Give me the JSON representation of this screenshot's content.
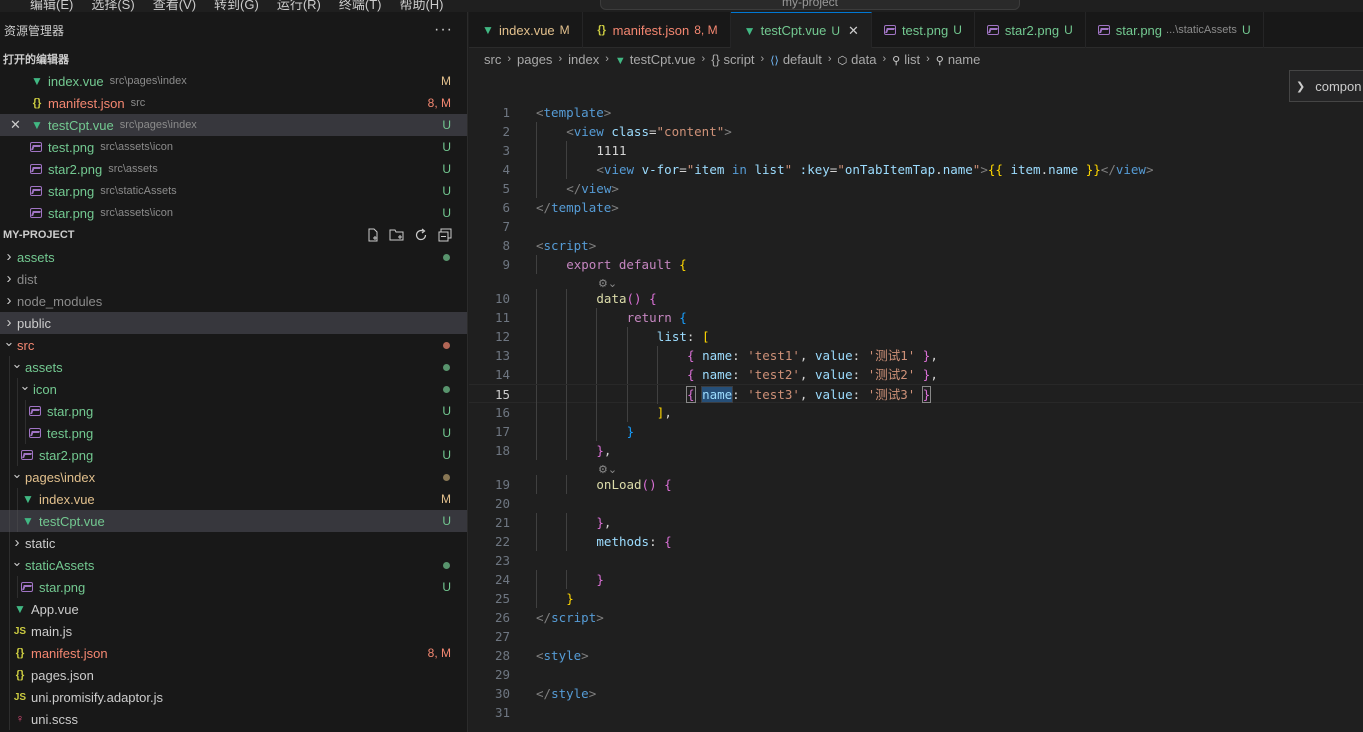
{
  "titlebar": {
    "menu": [
      "编辑(E)",
      "选择(S)",
      "查看(V)",
      "转到(G)",
      "运行(R)",
      "终端(T)",
      "帮助(H)"
    ],
    "command_center": "my-project"
  },
  "sidebar": {
    "title": "资源管理器",
    "more": "···",
    "open_editors_title": "打开的编辑器",
    "open_editors": [
      {
        "name": "index.vue",
        "path": "src\\pages\\index",
        "status": "M",
        "icon": "vue-icon",
        "color": "#73c991",
        "status_color": "#e2c08d"
      },
      {
        "name": "manifest.json",
        "path": "src",
        "status": "8, M",
        "icon": "json-icon",
        "color": "#f48771",
        "status_color": "#f48771"
      },
      {
        "name": "testCpt.vue",
        "path": "src\\pages\\index",
        "status": "U",
        "icon": "vue-icon",
        "color": "#73c991",
        "status_color": "#73c991",
        "selected": true
      },
      {
        "name": "test.png",
        "path": "src\\assets\\icon",
        "status": "U",
        "icon": "png-icon",
        "color": "#73c991",
        "status_color": "#73c991"
      },
      {
        "name": "star2.png",
        "path": "src\\assets",
        "status": "U",
        "icon": "png-icon",
        "color": "#73c991",
        "status_color": "#73c991"
      },
      {
        "name": "star.png",
        "path": "src\\staticAssets",
        "status": "U",
        "icon": "png-icon",
        "color": "#73c991",
        "status_color": "#73c991"
      },
      {
        "name": "star.png",
        "path": "src\\assets\\icon",
        "status": "U",
        "icon": "png-icon",
        "color": "#73c991",
        "status_color": "#73c991"
      }
    ],
    "project_title": "MY-PROJECT",
    "project_actions": [
      "new-file-icon",
      "new-folder-icon",
      "refresh-icon",
      "collapse-icon"
    ],
    "tree": [
      {
        "name": "assets",
        "level": 0,
        "type": "folder",
        "open": false,
        "color": "#73c991",
        "dot": "#73c991"
      },
      {
        "name": "dist",
        "level": 0,
        "type": "folder",
        "open": false,
        "color": "#8b8b8b"
      },
      {
        "name": "node_modules",
        "level": 0,
        "type": "folder",
        "open": false,
        "color": "#8b8b8b"
      },
      {
        "name": "public",
        "level": 0,
        "type": "folder",
        "open": false,
        "color": "#cccccc",
        "selected": true
      },
      {
        "name": "src",
        "level": 0,
        "type": "folder",
        "open": true,
        "color": "#f48771",
        "dot": "#f48771"
      },
      {
        "name": "assets",
        "level": 1,
        "type": "folder",
        "open": true,
        "color": "#73c991",
        "dot": "#73c991"
      },
      {
        "name": "icon",
        "level": 2,
        "type": "folder",
        "open": true,
        "color": "#73c991",
        "dot": "#73c991"
      },
      {
        "name": "star.png",
        "level": 3,
        "type": "png",
        "color": "#73c991",
        "status": "U"
      },
      {
        "name": "test.png",
        "level": 3,
        "type": "png",
        "color": "#73c991",
        "status": "U"
      },
      {
        "name": "star2.png",
        "level": 2,
        "type": "png",
        "color": "#73c991",
        "status": "U"
      },
      {
        "name": "pages\\index",
        "level": 1,
        "type": "folder",
        "open": true,
        "color": "#e2c08d",
        "dot": "#b89e6e"
      },
      {
        "name": "index.vue",
        "level": 2,
        "type": "vue",
        "color": "#e2c08d",
        "status": "M"
      },
      {
        "name": "testCpt.vue",
        "level": 2,
        "type": "vue",
        "color": "#73c991",
        "status": "U",
        "selected": true
      },
      {
        "name": "static",
        "level": 1,
        "type": "folder",
        "open": false,
        "color": "#cccccc"
      },
      {
        "name": "staticAssets",
        "level": 1,
        "type": "folder",
        "open": true,
        "color": "#73c991",
        "dot": "#73c991"
      },
      {
        "name": "star.png",
        "level": 2,
        "type": "png",
        "color": "#73c991",
        "status": "U"
      },
      {
        "name": "App.vue",
        "level": 1,
        "type": "vue",
        "color": "#cccccc"
      },
      {
        "name": "main.js",
        "level": 1,
        "type": "js",
        "color": "#cccccc"
      },
      {
        "name": "manifest.json",
        "level": 1,
        "type": "json",
        "color": "#f48771",
        "status": "8, M"
      },
      {
        "name": "pages.json",
        "level": 1,
        "type": "json",
        "color": "#cccccc"
      },
      {
        "name": "uni.promisify.adaptor.js",
        "level": 1,
        "type": "js",
        "color": "#cccccc"
      },
      {
        "name": "uni.scss",
        "level": 1,
        "type": "scss",
        "color": "#cccccc"
      }
    ]
  },
  "tabs": [
    {
      "name": "index.vue",
      "status": "M",
      "icon": "vue-icon",
      "color": "#e2c08d"
    },
    {
      "name": "manifest.json",
      "status": "8, M",
      "icon": "json-icon",
      "color": "#f48771"
    },
    {
      "name": "testCpt.vue",
      "status": "U",
      "icon": "vue-icon",
      "color": "#73c991",
      "active": true
    },
    {
      "name": "test.png",
      "status": "U",
      "icon": "png-icon",
      "color": "#73c991"
    },
    {
      "name": "star2.png",
      "status": "U",
      "icon": "png-icon",
      "color": "#73c991"
    },
    {
      "name": "star.png",
      "path": "...\\staticAssets",
      "status": "U",
      "icon": "png-icon",
      "color": "#73c991"
    }
  ],
  "breadcrumb": [
    "src",
    "pages",
    "index",
    "testCpt.vue",
    "{} script",
    "default",
    "data",
    "list",
    "name"
  ],
  "peek": {
    "label": "compon"
  },
  "editor": {
    "lines": [
      {
        "n": "1",
        "tokens": [
          [
            "t-br",
            "<"
          ],
          [
            "t-tag",
            "template"
          ],
          [
            "t-br",
            ">"
          ]
        ]
      },
      {
        "n": "2",
        "indent": 1,
        "tokens": [
          [
            "t-br",
            "<"
          ],
          [
            "t-tag",
            "view"
          ],
          [
            "t-txt",
            " "
          ],
          [
            "t-attr",
            "class"
          ],
          [
            "t-txt",
            "="
          ],
          [
            "t-str",
            "\"content\""
          ],
          [
            "t-br",
            ">"
          ]
        ]
      },
      {
        "n": "3",
        "indent": 2,
        "tokens": [
          [
            "t-txt",
            "1111"
          ]
        ]
      },
      {
        "n": "4",
        "indent": 2,
        "tokens": [
          [
            "t-br",
            "<"
          ],
          [
            "t-tag",
            "view"
          ],
          [
            "t-txt",
            " "
          ],
          [
            "t-attr",
            "v-for"
          ],
          [
            "t-txt",
            "="
          ],
          [
            "t-str",
            "\""
          ],
          [
            "t-attr",
            "item"
          ],
          [
            "t-txt",
            " "
          ],
          [
            "t-kw2",
            "in"
          ],
          [
            "t-txt",
            " "
          ],
          [
            "t-attr",
            "list"
          ],
          [
            "t-str",
            "\""
          ],
          [
            "t-txt",
            " "
          ],
          [
            "t-attr",
            ":key"
          ],
          [
            "t-txt",
            "="
          ],
          [
            "t-str",
            "\""
          ],
          [
            "t-attr",
            "onTabItemTap"
          ],
          [
            "t-txt",
            "."
          ],
          [
            "t-attr",
            "name"
          ],
          [
            "t-str",
            "\""
          ],
          [
            "t-br",
            ">"
          ],
          [
            "t-b1",
            "{{"
          ],
          [
            "t-txt",
            " "
          ],
          [
            "t-attr",
            "item"
          ],
          [
            "t-txt",
            "."
          ],
          [
            "t-attr",
            "name"
          ],
          [
            "t-txt",
            " "
          ],
          [
            "t-b1",
            "}}"
          ],
          [
            "t-br",
            "</"
          ],
          [
            "t-tag",
            "view"
          ],
          [
            "t-br",
            ">"
          ]
        ]
      },
      {
        "n": "5",
        "indent": 1,
        "tokens": [
          [
            "t-br",
            "</"
          ],
          [
            "t-tag",
            "view"
          ],
          [
            "t-br",
            ">"
          ]
        ]
      },
      {
        "n": "6",
        "tokens": [
          [
            "t-br",
            "</"
          ],
          [
            "t-tag",
            "template"
          ],
          [
            "t-br",
            ">"
          ]
        ]
      },
      {
        "n": "7",
        "tokens": []
      },
      {
        "n": "8",
        "tokens": [
          [
            "t-br",
            "<"
          ],
          [
            "t-tag",
            "script"
          ],
          [
            "t-br",
            ">"
          ]
        ]
      },
      {
        "n": "9",
        "indent": 1,
        "tokens": [
          [
            "t-kw",
            "export"
          ],
          [
            "t-txt",
            " "
          ],
          [
            "t-kw",
            "default"
          ],
          [
            "t-txt",
            " "
          ],
          [
            "t-b1",
            "{"
          ]
        ]
      },
      {
        "n": "",
        "lens": true
      },
      {
        "n": "10",
        "indent": 2,
        "tokens": [
          [
            "t-fn",
            "data"
          ],
          [
            "t-b2",
            "()"
          ],
          [
            "t-txt",
            " "
          ],
          [
            "t-b2",
            "{"
          ]
        ]
      },
      {
        "n": "11",
        "indent": 3,
        "tokens": [
          [
            "t-kw",
            "return"
          ],
          [
            "t-txt",
            " "
          ],
          [
            "t-b3",
            "{"
          ]
        ]
      },
      {
        "n": "12",
        "indent": 4,
        "tokens": [
          [
            "t-prop",
            "list"
          ],
          [
            "t-txt",
            ": "
          ],
          [
            "t-b1",
            "["
          ]
        ]
      },
      {
        "n": "13",
        "indent": 5,
        "tokens": [
          [
            "t-b2",
            "{"
          ],
          [
            "t-txt",
            " "
          ],
          [
            "t-prop",
            "name"
          ],
          [
            "t-txt",
            ": "
          ],
          [
            "t-str",
            "'test1'"
          ],
          [
            "t-txt",
            ", "
          ],
          [
            "t-prop",
            "value"
          ],
          [
            "t-txt",
            ": "
          ],
          [
            "t-str",
            "'测试1'"
          ],
          [
            "t-txt",
            " "
          ],
          [
            "t-b2",
            "}"
          ],
          [
            "t-txt",
            ","
          ]
        ]
      },
      {
        "n": "14",
        "indent": 5,
        "tokens": [
          [
            "t-b2",
            "{"
          ],
          [
            "t-txt",
            " "
          ],
          [
            "t-prop",
            "name"
          ],
          [
            "t-txt",
            ": "
          ],
          [
            "t-str",
            "'test2'"
          ],
          [
            "t-txt",
            ", "
          ],
          [
            "t-prop",
            "value"
          ],
          [
            "t-txt",
            ": "
          ],
          [
            "t-str",
            "'测试2'"
          ],
          [
            "t-txt",
            " "
          ],
          [
            "t-b2",
            "}"
          ],
          [
            "t-txt",
            ","
          ]
        ]
      },
      {
        "n": "15",
        "indent": 5,
        "current": true,
        "tokens": [
          [
            "t-b2 bmatch",
            "{"
          ],
          [
            "t-txt",
            " "
          ],
          [
            "t-prop hl",
            "name"
          ],
          [
            "t-txt",
            ": "
          ],
          [
            "t-str",
            "'test3'"
          ],
          [
            "t-txt",
            ", "
          ],
          [
            "t-prop",
            "value"
          ],
          [
            "t-txt",
            ": "
          ],
          [
            "t-str",
            "'测试3'"
          ],
          [
            "t-txt",
            " "
          ],
          [
            "t-b2 bmatch",
            "}"
          ]
        ]
      },
      {
        "n": "16",
        "indent": 4,
        "tokens": [
          [
            "t-b1",
            "]"
          ],
          [
            "t-txt",
            ","
          ]
        ]
      },
      {
        "n": "17",
        "indent": 3,
        "tokens": [
          [
            "t-b3",
            "}"
          ]
        ]
      },
      {
        "n": "18",
        "indent": 2,
        "tokens": [
          [
            "t-b2",
            "}"
          ],
          [
            "t-txt",
            ","
          ]
        ]
      },
      {
        "n": "",
        "lens": true
      },
      {
        "n": "19",
        "indent": 2,
        "tokens": [
          [
            "t-fn",
            "onLoad"
          ],
          [
            "t-b2",
            "()"
          ],
          [
            "t-txt",
            " "
          ],
          [
            "t-b2",
            "{"
          ]
        ]
      },
      {
        "n": "20",
        "tokens": []
      },
      {
        "n": "21",
        "indent": 2,
        "tokens": [
          [
            "t-b2",
            "}"
          ],
          [
            "t-txt",
            ","
          ]
        ]
      },
      {
        "n": "22",
        "indent": 2,
        "tokens": [
          [
            "t-prop",
            "methods"
          ],
          [
            "t-txt",
            ": "
          ],
          [
            "t-b2",
            "{"
          ]
        ]
      },
      {
        "n": "23",
        "tokens": []
      },
      {
        "n": "24",
        "indent": 2,
        "tokens": [
          [
            "t-b2",
            "}"
          ]
        ]
      },
      {
        "n": "25",
        "indent": 1,
        "tokens": [
          [
            "t-b1",
            "}"
          ]
        ]
      },
      {
        "n": "26",
        "tokens": [
          [
            "t-br",
            "</"
          ],
          [
            "t-tag",
            "script"
          ],
          [
            "t-br",
            ">"
          ]
        ]
      },
      {
        "n": "27",
        "tokens": []
      },
      {
        "n": "28",
        "tokens": [
          [
            "t-br",
            "<"
          ],
          [
            "t-tag",
            "style"
          ],
          [
            "t-br",
            ">"
          ]
        ]
      },
      {
        "n": "29",
        "tokens": []
      },
      {
        "n": "30",
        "tokens": [
          [
            "t-br",
            "</"
          ],
          [
            "t-tag",
            "style"
          ],
          [
            "t-br",
            ">"
          ]
        ]
      },
      {
        "n": "31",
        "tokens": []
      }
    ]
  }
}
